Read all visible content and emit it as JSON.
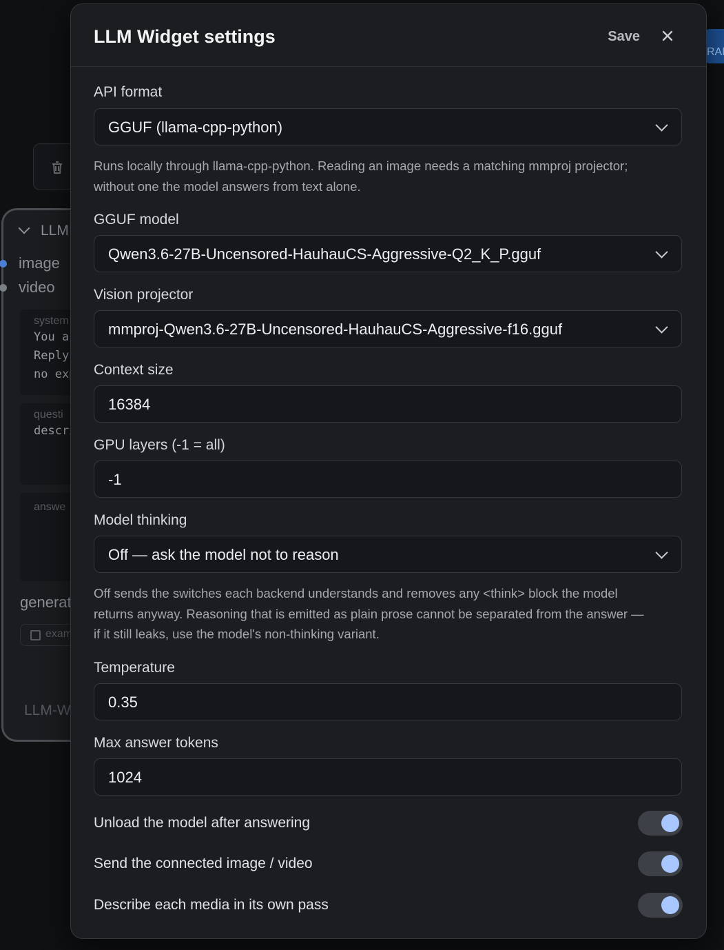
{
  "background": {
    "top_button_text": "RAN",
    "node": {
      "title": "LLM",
      "ports": [
        "image",
        "video"
      ],
      "system_label": "system",
      "system_lines": [
        "You ar",
        "Reply ",
        "no exp"
      ],
      "question_label": "questi",
      "question_lines": [
        "descri"
      ],
      "answer_label": "answe",
      "generate_label": "generat",
      "example_label": "exam",
      "footer": "LLM-W"
    },
    "port_colors": {
      "image": "#4a7fd1",
      "video": "#7b7f86"
    }
  },
  "modal": {
    "title": "LLM Widget settings",
    "save_label": "Save",
    "close_icon": "close-icon",
    "api_format": {
      "label": "API format",
      "value": "GGUF (llama-cpp-python)",
      "help": [
        "Runs locally through llama-cpp-python. Reading an image needs a matching mmproj projector;",
        "without one the model answers from text alone."
      ]
    },
    "gguf_model": {
      "label": "GGUF model",
      "value": "Qwen3.6-27B-Uncensored-HauhauCS-Aggressive-Q2_K_P.gguf"
    },
    "vision_projector": {
      "label": "Vision projector",
      "value": "mmproj-Qwen3.6-27B-Uncensored-HauhauCS-Aggressive-f16.gguf"
    },
    "context_size": {
      "label": "Context size",
      "value": "16384"
    },
    "gpu_layers": {
      "label": "GPU layers (-1 = all)",
      "value": "-1"
    },
    "model_thinking": {
      "label": "Model thinking",
      "value": "Off — ask the model not to reason",
      "help": [
        "Off sends the switches each backend understands and removes any <think> block the model",
        "returns anyway. Reasoning that is emitted as plain prose cannot be separated from the answer —",
        "if it still leaks, use the model's non-thinking variant."
      ]
    },
    "temperature": {
      "label": "Temperature",
      "value": "0.35"
    },
    "max_answer_tokens": {
      "label": "Max answer tokens",
      "value": "1024"
    },
    "toggles": [
      {
        "label": "Unload the model after answering",
        "on": true
      },
      {
        "label": "Send the connected image / video",
        "on": true
      },
      {
        "label": "Describe each media in its own pass",
        "on": true
      }
    ],
    "colors": {
      "toggle_knob": "#a9c7ff",
      "toggle_track": "#3d4046",
      "modal_bg": "#1c1d21"
    }
  }
}
